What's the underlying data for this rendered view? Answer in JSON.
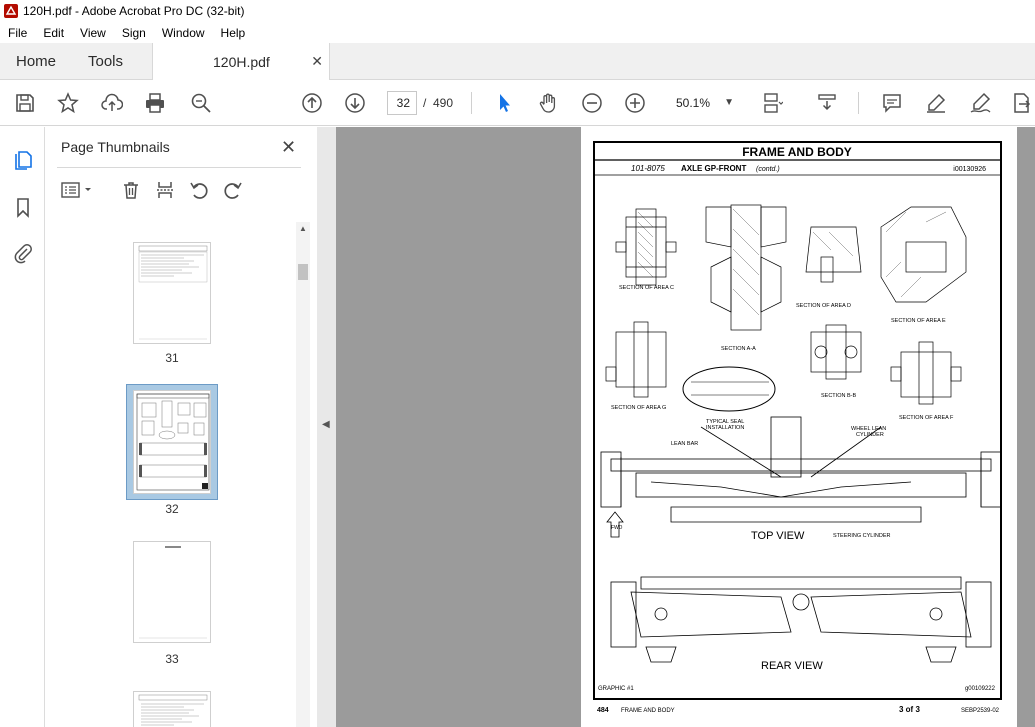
{
  "window": {
    "title": "120H.pdf - Adobe Acrobat Pro DC (32-bit)"
  },
  "menu": [
    "File",
    "Edit",
    "View",
    "Sign",
    "Window",
    "Help"
  ],
  "tabs": {
    "home": "Home",
    "tools": "Tools",
    "document": "120H.pdf"
  },
  "toolbar": {
    "current_page": "32",
    "page_separator": "/",
    "total_pages": "490",
    "zoom": "50.1%"
  },
  "thumbnails_pane": {
    "title": "Page Thumbnails",
    "pages": [
      "31",
      "32",
      "33"
    ]
  },
  "document_page": {
    "header": "FRAME AND BODY",
    "part_number": "101-8075",
    "part_desc": "AXLE GP-FRONT",
    "contd": "(contd.)",
    "illus_id": "i00130926",
    "labels": {
      "sec_c": "SECTION OF AREA C",
      "sec_aa": "SECTION A-A",
      "sec_d": "SECTION OF AREA D",
      "sec_e": "SECTION OF AREA E",
      "sec_g": "SECTION OF AREA G",
      "sec_bb": "SECTION B-B",
      "sec_f": "SECTION OF AREA F",
      "seal1": "TYPICAL SEAL",
      "seal2": "INSTALLATION",
      "lean_bar": "LEAN BAR",
      "wheel1": "WHEEL LEAN",
      "wheel2": "CYLINDER",
      "top_view": "TOP VIEW",
      "steering": "STEERING CYLINDER",
      "rear_view": "REAR VIEW",
      "fwd": "FWD",
      "graphic": "GRAPHIC #1",
      "graphic_id": "g00109222"
    },
    "footer": {
      "page_no": "484",
      "section": "FRAME AND BODY",
      "of": "3 of 3",
      "doc": "SEBP2539-02"
    }
  },
  "colors": {
    "accent": "#1473e6",
    "doc_bg": "#9b9b9b",
    "selected_thumb": "#a9c9e3"
  }
}
